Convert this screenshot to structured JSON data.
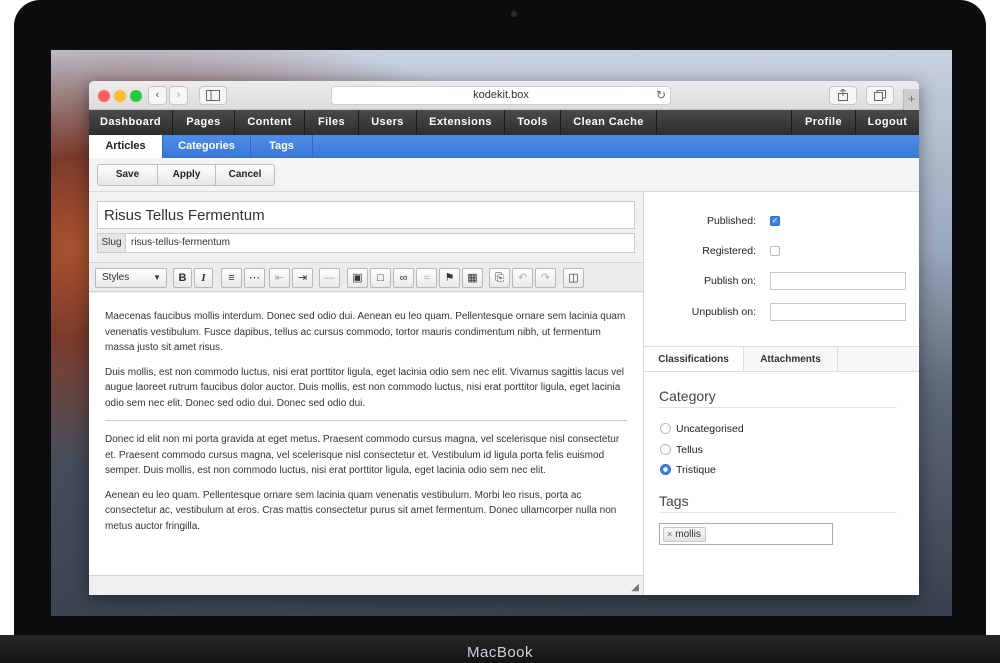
{
  "device": {
    "brand": "MacBook"
  },
  "browser": {
    "url": "kodekit.box",
    "plus_label": "+"
  },
  "topnav": {
    "items": [
      "Dashboard",
      "Pages",
      "Content",
      "Files",
      "Users",
      "Extensions",
      "Tools",
      "Clean Cache"
    ],
    "right": [
      "Profile",
      "Logout"
    ]
  },
  "subnav": {
    "items": [
      "Articles",
      "Categories",
      "Tags"
    ],
    "active": "Articles"
  },
  "toolbar": {
    "save": "Save",
    "apply": "Apply",
    "cancel": "Cancel"
  },
  "article": {
    "title": "Risus Tellus Fermentum",
    "slug_label": "Slug",
    "slug": "risus-tellus-fermentum"
  },
  "editor": {
    "styles_label": "Styles",
    "paragraphs_before_break": [
      "Maecenas faucibus mollis interdum. Donec sed odio dui. Aenean eu leo quam. Pellentesque ornare sem lacinia quam venenatis vestibulum. Fusce dapibus, tellus ac cursus commodo, tortor mauris condimentum nibh, ut fermentum massa justo sit amet risus.",
      "Duis mollis, est non commodo luctus, nisi erat porttitor ligula, eget lacinia odio sem nec elit. Vivamus sagittis lacus vel augue laoreet rutrum faucibus dolor auctor. Duis mollis, est non commodo luctus, nisi erat porttitor ligula, eget lacinia odio sem nec elit. Donec sed odio dui. Donec sed odio dui."
    ],
    "paragraphs_after_break": [
      "Donec id elit non mi porta gravida at eget metus. Praesent commodo cursus magna, vel scelerisque nisl consectetur et. Praesent commodo cursus magna, vel scelerisque nisl consectetur et. Vestibulum id ligula porta felis euismod semper. Duis mollis, est non commodo luctus, nisi erat porttitor ligula, eget lacinia odio sem nec elit.",
      "Aenean eu leo quam. Pellentesque ornare sem lacinia quam venenatis vestibulum. Morbi leo risus, porta ac consectetur ac, vestibulum at eros. Cras mattis consectetur purus sit amet fermentum. Donec ullamcorper nulla non metus auctor fringilla."
    ]
  },
  "publishing": {
    "published_label": "Published:",
    "published": true,
    "registered_label": "Registered:",
    "registered": false,
    "publish_on_label": "Publish on:",
    "publish_on_value": "",
    "unpublish_on_label": "Unpublish on:",
    "unpublish_on_value": ""
  },
  "side_tabs": {
    "items": [
      "Classifications",
      "Attachments"
    ],
    "active": "Classifications"
  },
  "category": {
    "title": "Category",
    "options": [
      "Uncategorised",
      "Tellus",
      "Tristique"
    ],
    "selected": "Tristique"
  },
  "tags": {
    "title": "Tags",
    "items": [
      "mollis"
    ]
  },
  "colors": {
    "nav_dark": "#2d2d2d",
    "subnav_blue": "#3976d6",
    "accent": "#3b82e0"
  }
}
